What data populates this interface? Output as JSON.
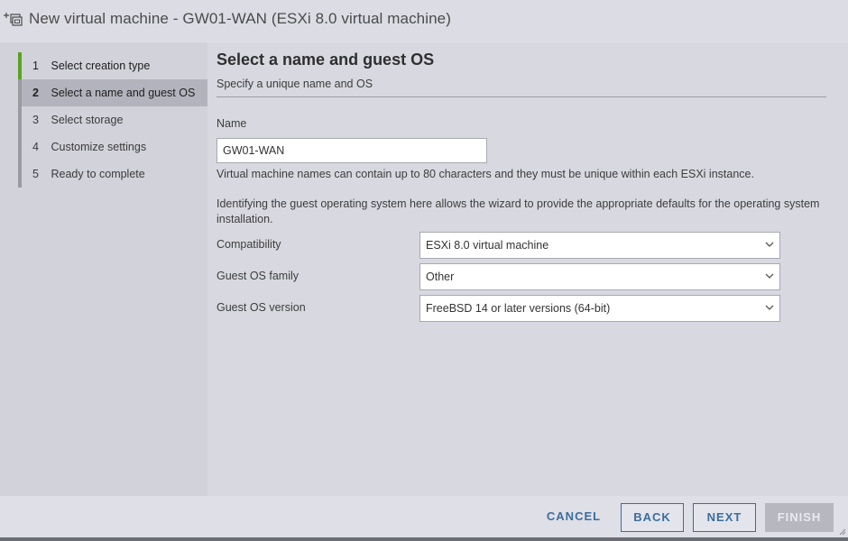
{
  "dialog": {
    "title": "New virtual machine - GW01-WAN (ESXi 8.0 virtual machine)",
    "icon": "new-vm-icon"
  },
  "steps": [
    {
      "num": "1",
      "label": "Select creation type",
      "state": "done"
    },
    {
      "num": "2",
      "label": "Select a name and guest OS",
      "state": "active"
    },
    {
      "num": "3",
      "label": "Select storage",
      "state": "pending"
    },
    {
      "num": "4",
      "label": "Customize settings",
      "state": "pending"
    },
    {
      "num": "5",
      "label": "Ready to complete",
      "state": "pending"
    }
  ],
  "page": {
    "title": "Select a name and guest OS",
    "subtitle": "Specify a unique name and OS",
    "name_label": "Name",
    "name_value": "GW01-WAN",
    "name_help": "Virtual machine names can contain up to 80 characters and they must be unique within each ESXi instance.",
    "os_help": "Identifying the guest operating system here allows the wizard to provide the appropriate defaults for the operating system installation.",
    "compatibility_label": "Compatibility",
    "compatibility_value": "ESXi 8.0 virtual machine",
    "os_family_label": "Guest OS family",
    "os_family_value": "Other",
    "os_version_label": "Guest OS version",
    "os_version_value": "FreeBSD 14 or later versions (64-bit)"
  },
  "footer": {
    "cancel": "CANCEL",
    "back": "BACK",
    "next": "NEXT",
    "finish": "FINISH"
  },
  "colors": {
    "accent_blue": "#3a6e9d",
    "step_done_green": "#5aa220",
    "active_step_bg": "#b3b3bd"
  }
}
